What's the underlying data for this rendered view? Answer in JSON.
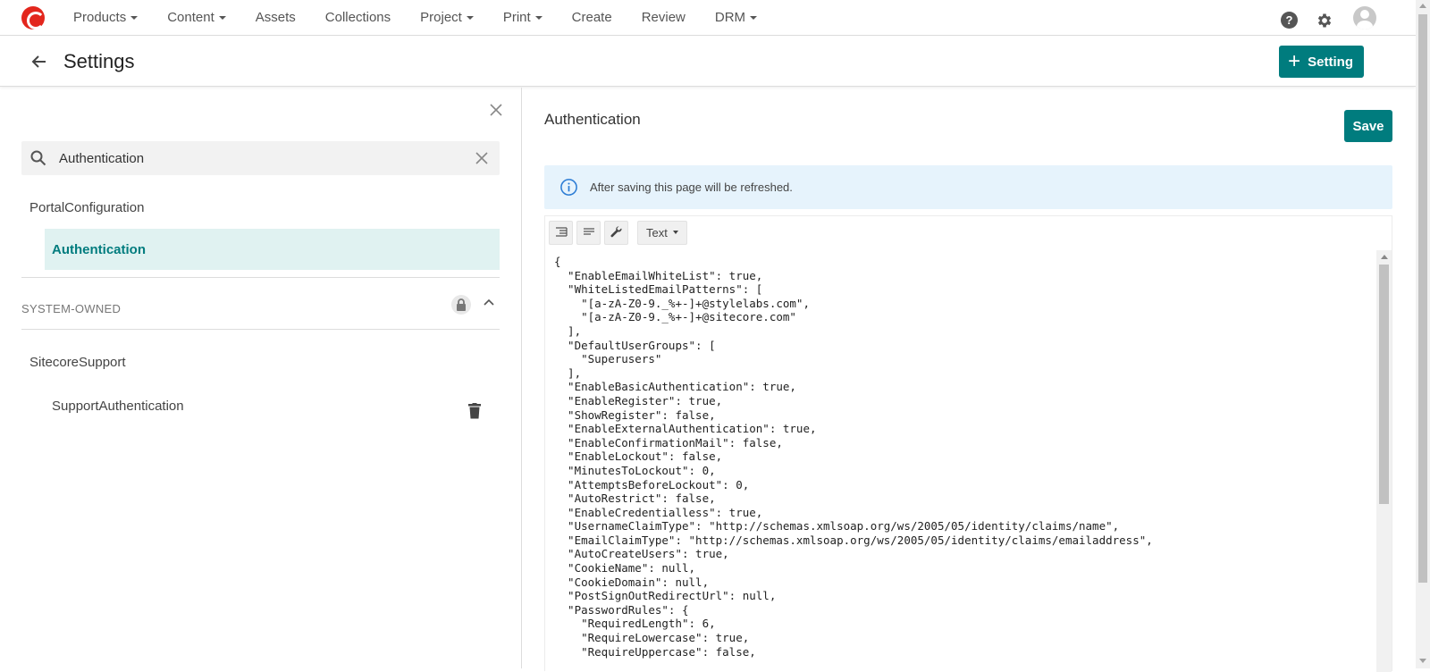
{
  "nav": {
    "items": [
      {
        "label": "Products",
        "dropdown": true
      },
      {
        "label": "Content",
        "dropdown": true
      },
      {
        "label": "Assets",
        "dropdown": false
      },
      {
        "label": "Collections",
        "dropdown": false
      },
      {
        "label": "Project",
        "dropdown": true
      },
      {
        "label": "Print",
        "dropdown": true
      },
      {
        "label": "Create",
        "dropdown": false
      },
      {
        "label": "Review",
        "dropdown": false
      },
      {
        "label": "DRM",
        "dropdown": true
      }
    ],
    "help_glyph": "?"
  },
  "header": {
    "title": "Settings",
    "add_button_label": "Setting",
    "add_button_glyph": "+"
  },
  "sidebar": {
    "search_value": "Authentication",
    "groups": {
      "portal": "PortalConfiguration",
      "portal_item": "Authentication",
      "system_owned_label": "SYSTEM-OWNED",
      "sitecore": "SitecoreSupport",
      "sitecore_item": "SupportAuthentication"
    }
  },
  "main": {
    "title": "Authentication",
    "save_label": "Save",
    "info_text": "After saving this page will be refreshed.",
    "editor_mode": "Text",
    "json_text": "{\n  \"EnableEmailWhiteList\": true,\n  \"WhiteListedEmailPatterns\": [\n    \"[a-zA-Z0-9._%+-]+@stylelabs.com\",\n    \"[a-zA-Z0-9._%+-]+@sitecore.com\"\n  ],\n  \"DefaultUserGroups\": [\n    \"Superusers\"\n  ],\n  \"EnableBasicAuthentication\": true,\n  \"EnableRegister\": true,\n  \"ShowRegister\": false,\n  \"EnableExternalAuthentication\": true,\n  \"EnableConfirmationMail\": false,\n  \"EnableLockout\": false,\n  \"MinutesToLockout\": 0,\n  \"AttemptsBeforeLockout\": 0,\n  \"AutoRestrict\": false,\n  \"EnableCredentialless\": true,\n  \"UsernameClaimType\": \"http://schemas.xmlsoap.org/ws/2005/05/identity/claims/name\",\n  \"EmailClaimType\": \"http://schemas.xmlsoap.org/ws/2005/05/identity/claims/emailaddress\",\n  \"AutoCreateUsers\": true,\n  \"CookieName\": null,\n  \"CookieDomain\": null,\n  \"PostSignOutRedirectUrl\": null,\n  \"PasswordRules\": {\n    \"RequiredLength\": 6,\n    \"RequireLowercase\": true,\n    \"RequireUppercase\": false,"
  },
  "colors": {
    "accent": "#007c7e",
    "active_bg": "#e0f2f1",
    "info_bg": "#e6f3fc",
    "logo": "#e3261d"
  },
  "icons": [
    "logo-icon",
    "help-icon",
    "gear-icon",
    "avatar",
    "back-arrow-icon",
    "plus-icon",
    "close-icon",
    "search-icon",
    "clear-icon",
    "lock-icon",
    "chevron-up-icon",
    "trash-icon",
    "info-icon",
    "format-icon",
    "compact-icon",
    "wrench-icon"
  ]
}
